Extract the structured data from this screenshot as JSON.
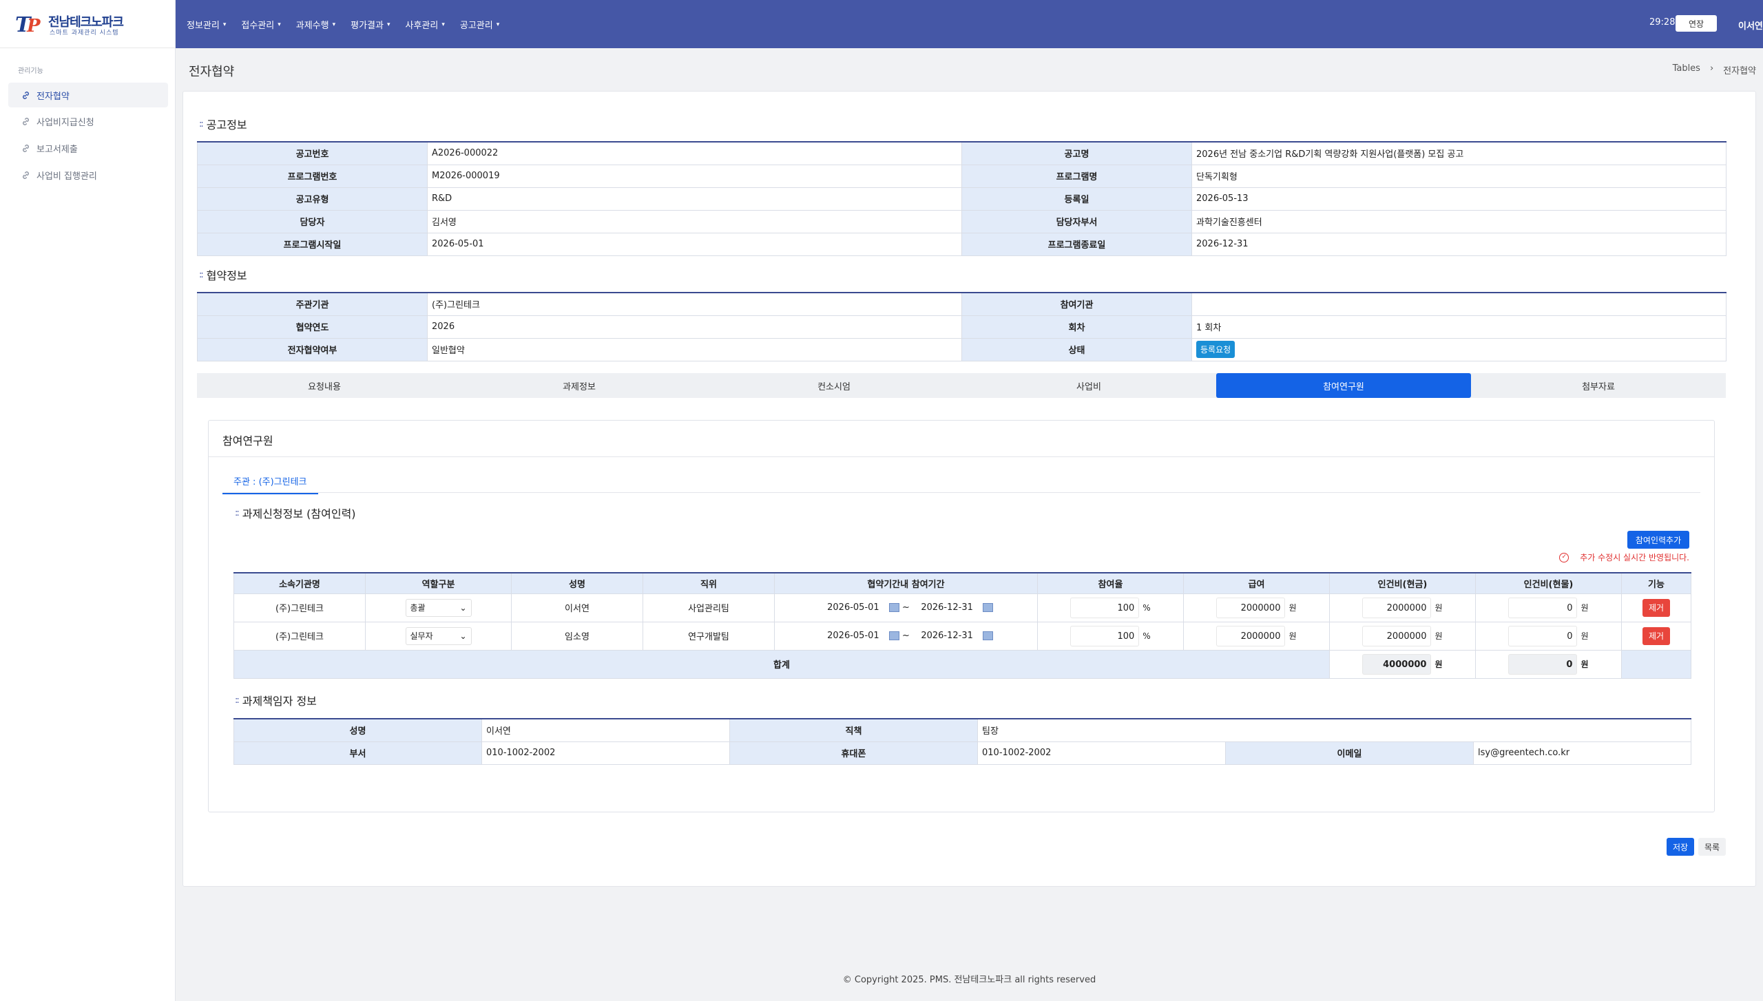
{
  "brand": {
    "title": "전남테크노파크",
    "subtitle": "스마트 과제관리 시스템"
  },
  "sidebar": {
    "group_label": "관리기능",
    "items": [
      {
        "label": "전자협약",
        "active": true
      },
      {
        "label": "사업비지급신청"
      },
      {
        "label": "보고서제출"
      },
      {
        "label": "사업비 집행관리"
      }
    ]
  },
  "topbar": {
    "menu": [
      "정보관리",
      "접수관리",
      "과제수행",
      "평가결과",
      "사후관리",
      "공고관리"
    ],
    "timer": "29:28",
    "extend_label": "연장",
    "user_name": "이서연"
  },
  "page": {
    "title": "전자협약",
    "breadcrumb": [
      "Tables",
      "전자협약"
    ]
  },
  "notice_info": {
    "title": "공고정보",
    "rows": [
      [
        "공고번호",
        "A2026-000022",
        "공고명",
        "2026년 전남 중소기업 R&D기획 역량강화 지원사업(플랫폼) 모집 공고"
      ],
      [
        "프로그램번호",
        "M2026-000019",
        "프로그램명",
        "단독기획형"
      ],
      [
        "공고유형",
        "R&D",
        "등록일",
        "2026-05-13"
      ],
      [
        "담당자",
        "김서영",
        "담당자부서",
        "과학기술진흥센터"
      ],
      [
        "프로그램시작일",
        "2026-05-01",
        "프로그램종료일",
        "2026-12-31"
      ]
    ]
  },
  "agreement_info": {
    "title": "협약정보",
    "rows": [
      [
        "주관기관",
        "(주)그린테크",
        "참여기관",
        ""
      ],
      [
        "협약연도",
        "2026",
        "회차",
        "1 회차"
      ],
      [
        "전자협약여부",
        "일반협약",
        "상태",
        "등록요청"
      ]
    ]
  },
  "tabs": [
    "요청내용",
    "과제정보",
    "컨소시엄",
    "사업비",
    "참여연구원",
    "첨부자료"
  ],
  "active_tab": 4,
  "researchers": {
    "panel_title": "참여연구원",
    "subtab": "주관 : (주)그린테크",
    "section_title": "과제신청정보 (참여인력)",
    "add_label": "참여인력추가",
    "notice": "추가 수정시 실시간 반영됩니다.",
    "columns": [
      "소속기관명",
      "역할구분",
      "성명",
      "직위",
      "협약기간내 참여기간",
      "참여율",
      "급여",
      "인건비(현금)",
      "인건비(현물)",
      "기능"
    ],
    "rows": [
      {
        "org": "(주)그린테크",
        "role": "총괄",
        "name": "이서연",
        "position": "사업관리팀",
        "start": "2026-05-01",
        "end": "2026-12-31",
        "rate": "100",
        "salary": "2000000",
        "cash": "2000000",
        "inkind": "0"
      },
      {
        "org": "(주)그린테크",
        "role": "실무자",
        "name": "임소영",
        "position": "연구개발팀",
        "start": "2026-05-01",
        "end": "2026-12-31",
        "rate": "100",
        "salary": "2000000",
        "cash": "2000000",
        "inkind": "0"
      }
    ],
    "sum_label": "합계",
    "sum_cash": "4000000",
    "sum_inkind": "0",
    "unit_percent": "%",
    "unit_won": "원",
    "tilde": "~",
    "delete_label": "제거"
  },
  "pi": {
    "title": "과제책임자 정보",
    "name_label": "성명",
    "name": "이서연",
    "title_label": "직책",
    "title_value": "팀장",
    "dept_label": "부서",
    "dept": "010-1002-2002",
    "phone_label": "휴대폰",
    "phone": "010-1002-2002",
    "email_label": "이메일",
    "email": "lsy@greentech.co.kr"
  },
  "actions": {
    "save": "저장",
    "list": "목록"
  },
  "footer": "© Copyright 2025. PMS. 전남테크노파크 all rights reserved"
}
